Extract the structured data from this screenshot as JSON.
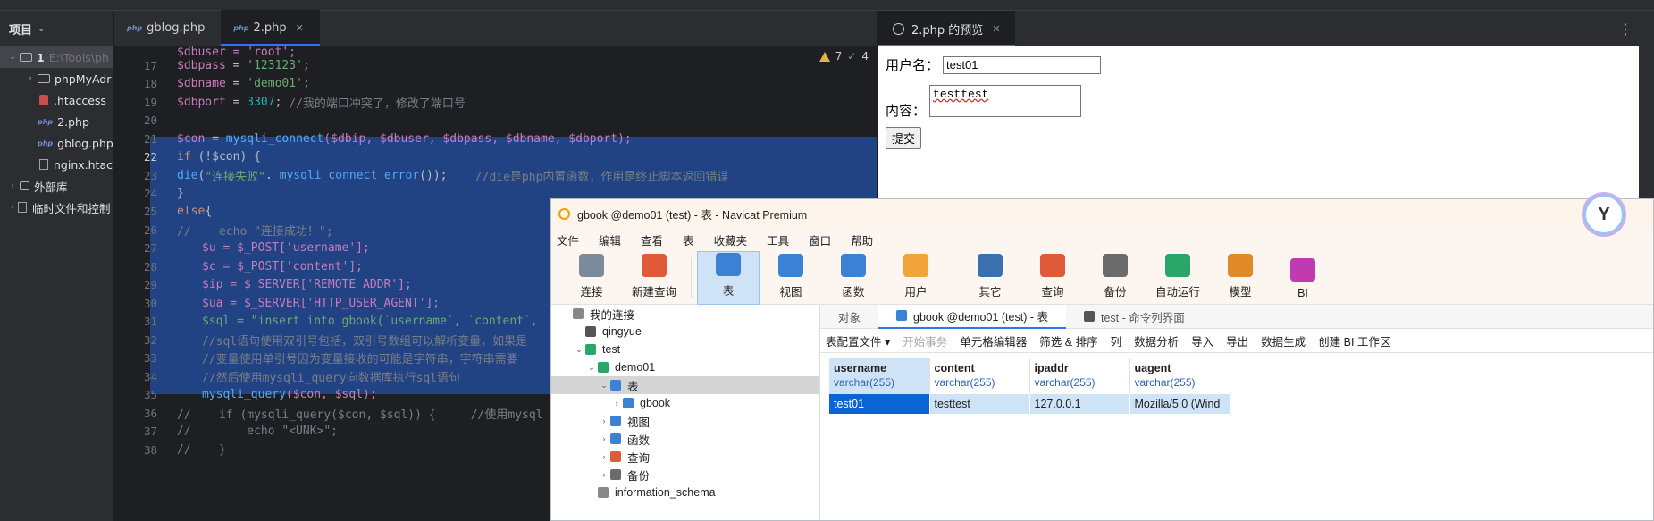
{
  "ide": {
    "project_label": "项目",
    "tree": [
      {
        "name": "1",
        "hint": "E:\\Tools\\ph",
        "kind": "root"
      },
      {
        "name": "phpMyAdr",
        "kind": "folder"
      },
      {
        "name": ".htaccess",
        "kind": "git"
      },
      {
        "name": "2.php",
        "kind": "php"
      },
      {
        "name": "gblog.php",
        "kind": "php"
      },
      {
        "name": "nginx.htac",
        "kind": "file"
      },
      {
        "name": "外部库",
        "kind": "lib"
      },
      {
        "name": "临时文件和控制",
        "kind": "scratch"
      }
    ],
    "tabs": [
      {
        "label": "gblog.php",
        "badge": "php"
      },
      {
        "label": "2.php",
        "badge": "php",
        "close": "✕"
      }
    ],
    "warnings": "7",
    "checks": "4",
    "line_numbers": [
      "17",
      "18",
      "19",
      "20",
      "21",
      "22",
      "23",
      "24",
      "25",
      "26",
      "27",
      "28",
      "29",
      "30",
      "31",
      "32",
      "33",
      "34",
      "35",
      "36",
      "37",
      "38"
    ],
    "code": {
      "l16": "$dbuser = 'root';",
      "l17_var": "$dbpass",
      "l17_str": "'123123'",
      "l18_var": "$dbname",
      "l18_str": "'demo01'",
      "l19_var": "$dbport",
      "l19_num": "3307",
      "l19_cm": "//我的端口冲突了，修改了端口号",
      "l21_a": "$con",
      "l21_fn": "mysqli_connect",
      "l21_args": "($dbip, $dbuser, $dbpass, $dbname, $dbport);",
      "l22_kw": "if",
      "l22_rest": " (!$con) {",
      "l23_fn": "die",
      "l23_str": "\"连接失败\"",
      "l23_fn2": "mysqli_connect_error",
      "l23_cm": "//die是php内置函数，作用是终止脚本返回错误",
      "l24": "}",
      "l25_kw": "else",
      "l26_cm": "//    echo \"连接成功！\";",
      "l27": "$u = $_POST['username'];",
      "l28": "$c = $_POST['content'];",
      "l29": "$ip = $_SERVER['REMOTE_ADDR'];",
      "l30": "$ua = $_SERVER['HTTP_USER_AGENT'];",
      "l31": "$sql = \"insert into gbook(`username`, `content`,",
      "l32_cm": "//sql语句使用双引号包括，双引号数组可以解析变量，如果是",
      "l33_cm": "//变量使用单引号因为变量接收的可能是字符串，字符串需要",
      "l34_cm": "//然后使用mysqli_query向数据库执行sql语句",
      "l35_fn": "mysqli_query",
      "l35_rest": "($con, $sql);",
      "l36_cm": "//    if (mysqli_query($con, $sql)) {     //使用mysql",
      "l37_cm": "//        echo \"<UNK>\";",
      "l38_cm": "//    }"
    }
  },
  "preview": {
    "tab_label": "2.php 的预览",
    "close": "✕",
    "menu": "⋮",
    "username_label": "用户名：",
    "username_value": "test01",
    "content_label": "内容：",
    "content_value": "testtest",
    "submit_label": "提交"
  },
  "navicat": {
    "title": "gbook @demo01 (test) - 表 - Navicat Premium",
    "menu": [
      "文件",
      "编辑",
      "查看",
      "表",
      "收藏夹",
      "工具",
      "窗口",
      "帮助"
    ],
    "toolbar": [
      {
        "label": "连接",
        "color": "#7d8a99"
      },
      {
        "label": "新建查询",
        "color": "#e05a3a"
      },
      {
        "label": "表",
        "color": "#3b82d6",
        "active": true
      },
      {
        "label": "视图",
        "color": "#3b82d6"
      },
      {
        "label": "函数",
        "color": "#3b82d6"
      },
      {
        "label": "用户",
        "color": "#f0a43a"
      },
      {
        "label": "其它",
        "color": "#3b6fb0"
      },
      {
        "label": "查询",
        "color": "#e05a3a"
      },
      {
        "label": "备份",
        "color": "#6b6b6b"
      },
      {
        "label": "自动运行",
        "color": "#2aa66a"
      },
      {
        "label": "模型",
        "color": "#e08a2a"
      },
      {
        "label": "BI",
        "color": "#c03ab0"
      }
    ],
    "sidebar": [
      {
        "label": "我的连接",
        "indent": 0,
        "arrow": "",
        "color": "#888"
      },
      {
        "label": "qingyue",
        "indent": 1,
        "arrow": "",
        "color": "#555"
      },
      {
        "label": "test",
        "indent": 1,
        "arrow": "⌄",
        "color": "#2aa66a"
      },
      {
        "label": "demo01",
        "indent": 2,
        "arrow": "⌄",
        "color": "#2aa66a"
      },
      {
        "label": "表",
        "indent": 3,
        "arrow": "⌄",
        "color": "#3b82d6",
        "sel": true
      },
      {
        "label": "gbook",
        "indent": 4,
        "arrow": "›",
        "color": "#3b82d6"
      },
      {
        "label": "视图",
        "indent": 3,
        "arrow": "›",
        "color": "#3b82d6"
      },
      {
        "label": "函数",
        "indent": 3,
        "arrow": "›",
        "color": "#3b82d6"
      },
      {
        "label": "查询",
        "indent": 3,
        "arrow": "›",
        "color": "#e05a3a"
      },
      {
        "label": "备份",
        "indent": 3,
        "arrow": "›",
        "color": "#6b6b6b"
      },
      {
        "label": "information_schema",
        "indent": 2,
        "arrow": "",
        "color": "#888"
      }
    ],
    "main_tabs": [
      "对象",
      "gbook @demo01 (test) - 表",
      "test - 命令列界面"
    ],
    "table_tools": [
      "表配置文件 ▾",
      "开始事务",
      "单元格编辑器",
      "筛选 & 排序",
      "列",
      "数据分析",
      "导入",
      "导出",
      "数据生成",
      "创建 BI 工作区"
    ],
    "columns": [
      {
        "name": "username",
        "type": "varchar(255)"
      },
      {
        "name": "content",
        "type": "varchar(255)"
      },
      {
        "name": "ipaddr",
        "type": "varchar(255)"
      },
      {
        "name": "uagent",
        "type": "varchar(255)"
      }
    ],
    "rows": [
      [
        "test01",
        "testtest",
        "127.0.0.1",
        "Mozilla/5.0 (Wind"
      ]
    ]
  }
}
